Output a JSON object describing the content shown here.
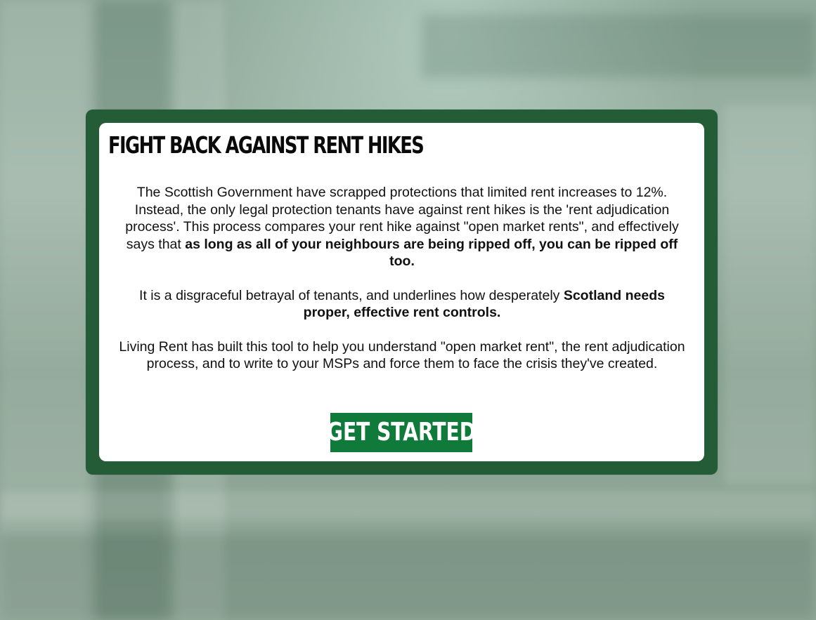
{
  "theme": {
    "frame_color": "#245c37",
    "button_color": "#0f7a3a",
    "backdrop_tint": "#8fa99a"
  },
  "modal": {
    "title": "FIGHT BACK AGAINST RENT HIKES",
    "paragraph1": {
      "text": "The Scottish Government have scrapped protections that limited rent increases to 12%. Instead, the only legal protection tenants have against rent hikes is the 'rent adjudication process'. This process compares your rent hike against \"open market rents\", and effectively says that ",
      "bold": "as long as all of your neighbours are being ripped off, you can be ripped off too."
    },
    "paragraph2": {
      "text": "It is a disgraceful betrayal of tenants, and underlines how desperately ",
      "bold": "Scotland needs proper, effective rent controls."
    },
    "paragraph3": {
      "text": "Living Rent has built this tool to help you understand \"open market rent\", the rent adjudication process, and to write to your MSPs and force them to face the crisis they've created."
    },
    "cta_label": "GET STARTED"
  }
}
